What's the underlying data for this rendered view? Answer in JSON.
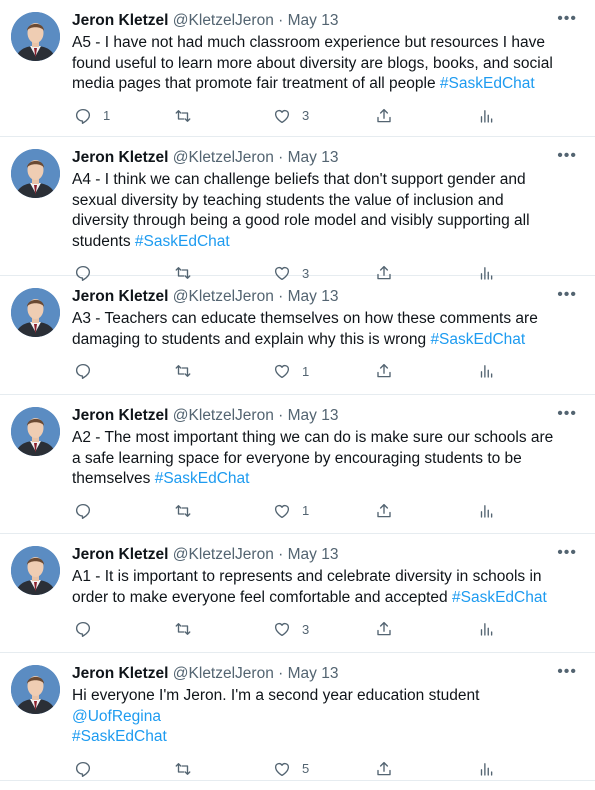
{
  "tweets": [
    {
      "name": "Jeron Kletzel",
      "handle": "@KletzelJeron",
      "date": "May 13",
      "text": "A5 - I have not had much classroom experience but resources I have found useful to learn more about diversity are blogs, books, and social media pages that promote fair treatment of all people ",
      "tags": [
        "#SaskEdChat"
      ],
      "replies": "1",
      "retweets": "",
      "likes": "3"
    },
    {
      "name": "Jeron Kletzel",
      "handle": "@KletzelJeron",
      "date": "May 13",
      "text": "A4 - I think we can challenge beliefs that don't support gender and sexual diversity by teaching students the value of inclusion and diversity through being a good role model and visibly supporting all students ",
      "tags": [
        "#SaskEdChat"
      ],
      "replies": "",
      "retweets": "",
      "likes": "3"
    },
    {
      "name": "Jeron Kletzel",
      "handle": "@KletzelJeron",
      "date": "May 13",
      "text": "A3 - Teachers can educate themselves on how these comments are damaging to students and explain why this is wrong ",
      "tags": [
        "#SaskEdChat"
      ],
      "replies": "",
      "retweets": "",
      "likes": "1"
    },
    {
      "name": "Jeron Kletzel",
      "handle": "@KletzelJeron",
      "date": "May 13",
      "text": "A2 - The most important thing we can do is make sure our schools are a safe learning space for everyone by encouraging students to be themselves ",
      "tags": [
        "#SaskEdChat"
      ],
      "replies": "",
      "retweets": "",
      "likes": "1"
    },
    {
      "name": "Jeron Kletzel",
      "handle": "@KletzelJeron",
      "date": "May 13",
      "text": "A1 - It is important to represents and celebrate diversity in schools in order to make everyone feel comfortable and accepted ",
      "tags": [
        "#SaskEdChat"
      ],
      "replies": "",
      "retweets": "",
      "likes": "3"
    },
    {
      "name": "Jeron Kletzel",
      "handle": "@KletzelJeron",
      "date": "May 13",
      "text": "Hi everyone I'm Jeron. I'm a second year education student ",
      "tags": [
        "@UofRegina",
        "#SaskEdChat"
      ],
      "replies": "",
      "retweets": "",
      "likes": "5"
    }
  ],
  "separator": "·",
  "more_icon": "more-horizontal-icon",
  "colors": {
    "text": "#0f1419",
    "secondary": "#536471",
    "link": "#1d9bf0",
    "divider": "#e6ecf0"
  }
}
